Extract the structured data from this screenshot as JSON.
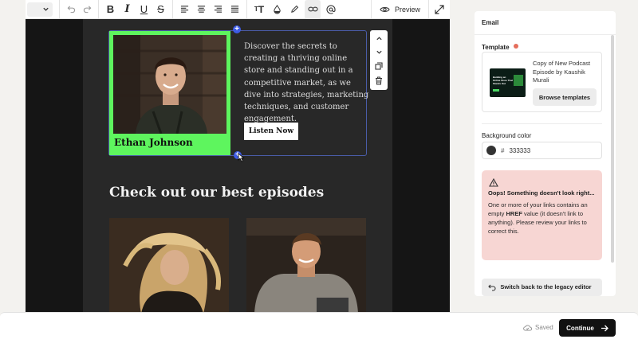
{
  "toolbar": {
    "dropdown_icon": "chevron-down-icon",
    "undo_icon": "undo-icon",
    "redo_icon": "redo-icon",
    "bold_label": "B",
    "italic_label": "I",
    "underline_label": "U",
    "strike_label": "S",
    "text_size_label": "T",
    "preview_label": "Preview"
  },
  "email": {
    "host_name": "Ethan Johnson",
    "hero_text": "Discover the secrets to creating a thriving online store and standing out in a competitive market, as we dive into strategies, marketing techniques, and customer engagement.",
    "listen_label": "Listen Now",
    "section_title": "Check out our best episodes",
    "background_color": "#282828",
    "photo_cell_color": "#5ef55e"
  },
  "panel": {
    "title": "Email",
    "template_label": "Template",
    "template_name": "Copy of New Podcast Episode by Kaushik Murali",
    "template_thumb_text": "Building an Online Store That Stands Out",
    "browse_label": "Browse templates",
    "background_color_label": "Background color",
    "background_color_hash": "#",
    "background_color_value": "333333",
    "alert_title": "Oops! Something doesn't look right...",
    "alert_body_pre": "One or more of your links contains an empty ",
    "alert_body_bold": "HREF",
    "alert_body_post": " value (it doesn't link to anything). Please review your links to correct this.",
    "legacy_label": "Switch back to the legacy editor"
  },
  "footer": {
    "saved_label": "Saved",
    "continue_label": "Continue"
  }
}
